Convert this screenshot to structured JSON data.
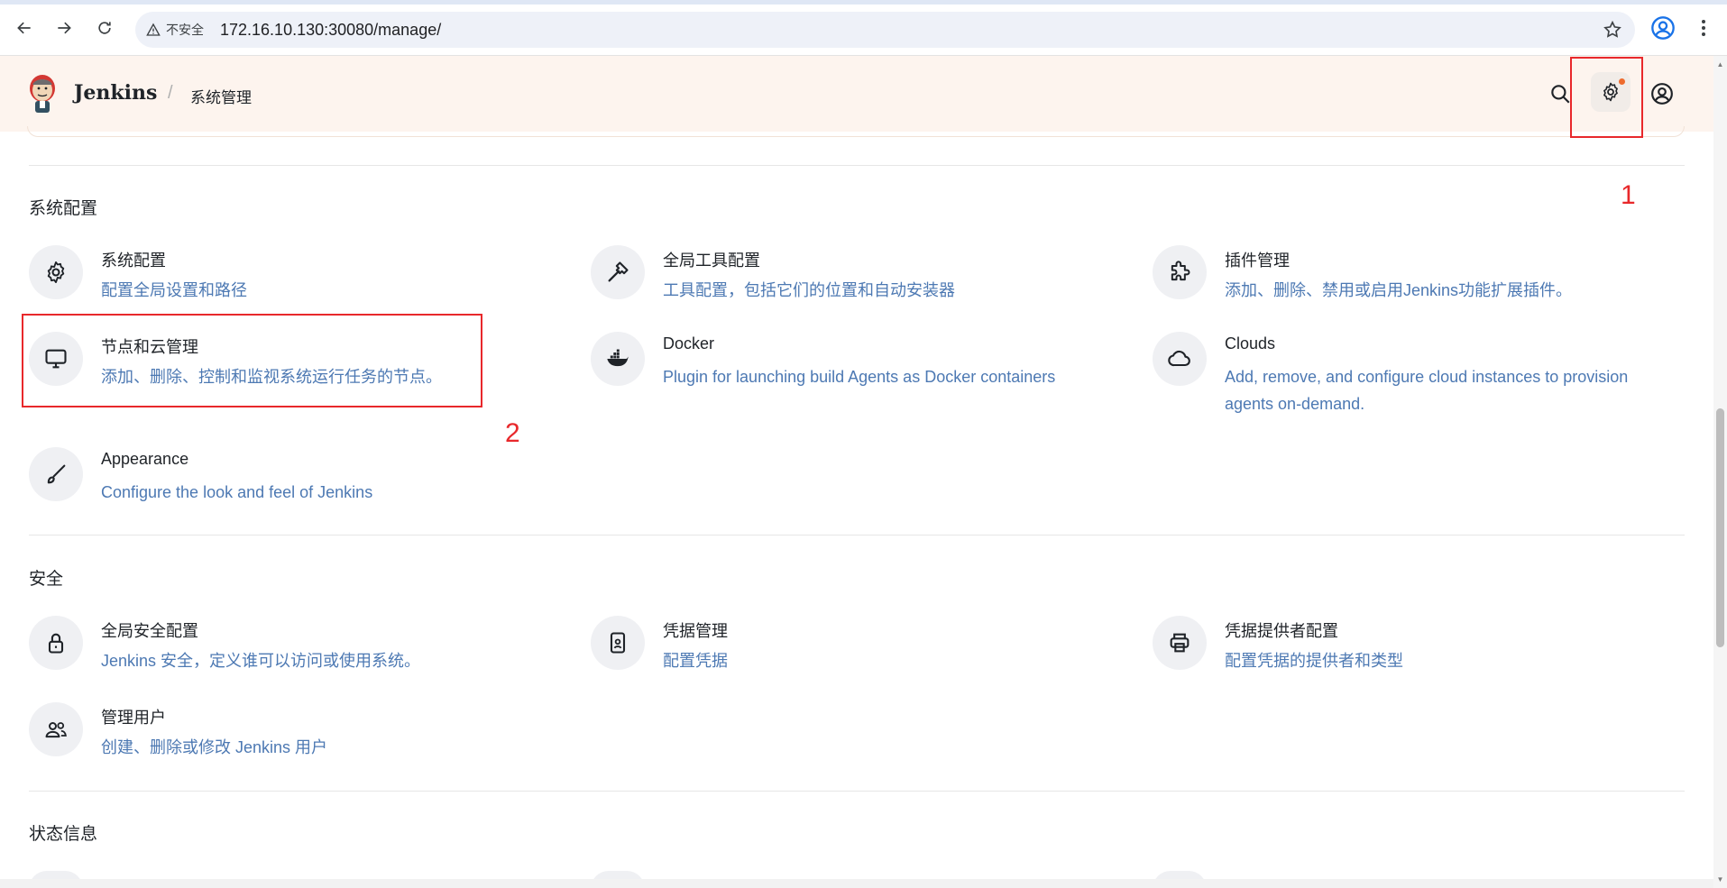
{
  "browser": {
    "insecure_label": "不安全",
    "url": "172.16.10.130:30080/manage/"
  },
  "header": {
    "app_title": "Jenkins",
    "breadcrumb": "系统管理"
  },
  "annotations": {
    "label_1": "1",
    "label_2": "2"
  },
  "sections": {
    "system_config": {
      "title": "系统配置",
      "items": [
        {
          "title": "系统配置",
          "desc": "配置全局设置和路径",
          "icon": "gear-icon"
        },
        {
          "title": "全局工具配置",
          "desc": "工具配置，包括它们的位置和自动安装器",
          "icon": "hammer-icon"
        },
        {
          "title": "插件管理",
          "desc": "添加、删除、禁用或启用Jenkins功能扩展插件。",
          "icon": "puzzle-icon"
        },
        {
          "title": "节点和云管理",
          "desc": "添加、删除、控制和监视系统运行任务的节点。",
          "icon": "monitor-icon"
        },
        {
          "title": "Docker",
          "desc": "Plugin for launching build Agents as Docker containers",
          "icon": "docker-icon"
        },
        {
          "title": "Clouds",
          "desc": "Add, remove, and configure cloud instances to provision agents on-demand.",
          "icon": "cloud-icon"
        },
        {
          "title": "Appearance",
          "desc": "Configure the look and feel of Jenkins",
          "icon": "brush-icon"
        }
      ]
    },
    "security": {
      "title": "安全",
      "items": [
        {
          "title": "全局安全配置",
          "desc": "Jenkins 安全，定义谁可以访问或使用系统。",
          "icon": "lock-icon"
        },
        {
          "title": "凭据管理",
          "desc": "配置凭据",
          "icon": "id-card-icon"
        },
        {
          "title": "凭据提供者配置",
          "desc": "配置凭据的提供者和类型",
          "icon": "printer-icon"
        },
        {
          "title": "管理用户",
          "desc": "创建、删除或修改 Jenkins 用户",
          "icon": "users-icon"
        }
      ]
    },
    "status": {
      "title": "状态信息"
    }
  },
  "colors": {
    "accent_link": "#4d79b3",
    "annotation_red": "#e8282b",
    "header_bg": "#fdf4ee",
    "notify_dot": "#ee6b2d"
  }
}
